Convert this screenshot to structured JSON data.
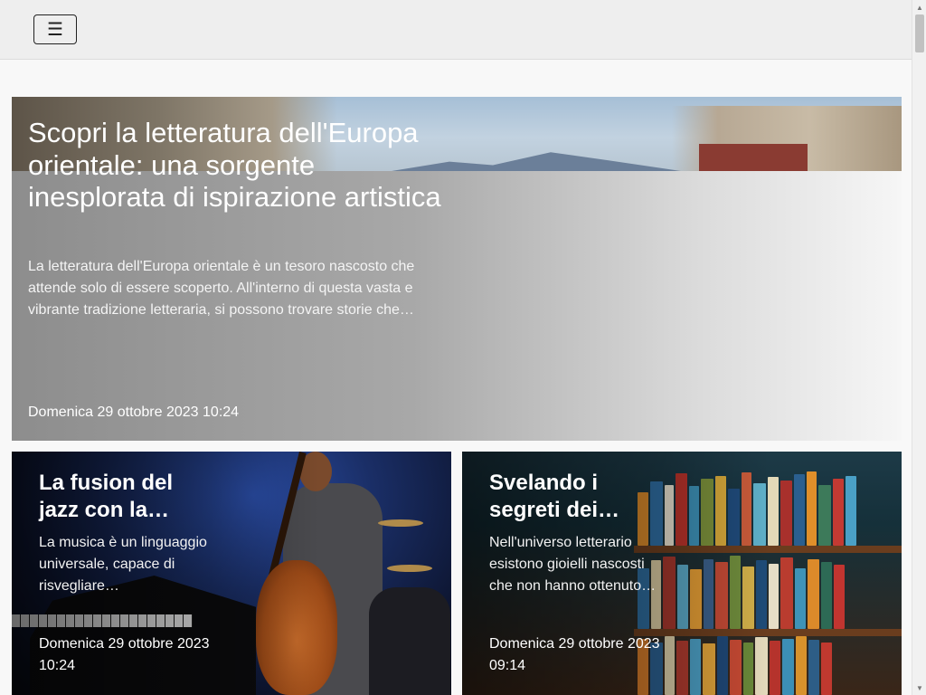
{
  "header": {
    "menu_icon": "☰"
  },
  "hero": {
    "title": "Scopri la letteratura dell'Europa orientale: una sorgente inesplorata di ispirazione artistica",
    "excerpt": "La letteratura dell'Europa orientale è un tesoro nascosto che attende solo di essere scoperto. All'interno di questa vasta e vibrante tradizione letteraria, si possono trovare storie che…",
    "date": "Domenica 29 ottobre 2023 10:24"
  },
  "cards": [
    {
      "title": "La fusion del jazz con la…",
      "excerpt": "La musica è un linguaggio universale, capace di risvegliare…",
      "date": "Domenica 29 ottobre 2023 10:24"
    },
    {
      "title": "Svelando i segreti dei…",
      "excerpt": "Nell'universo letterario esistono gioielli nascosti che non hanno ottenuto…",
      "date": "Domenica 29 ottobre 2023 09:14"
    }
  ],
  "scrollbar": {
    "up_arrow": "▲",
    "down_arrow": "▼"
  }
}
